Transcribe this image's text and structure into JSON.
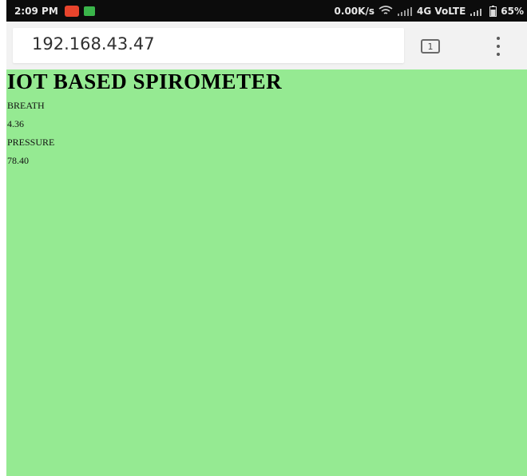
{
  "status_bar": {
    "time": "2:09 PM",
    "network_speed": "0.00K/s",
    "network_type": "4G VoLTE",
    "battery": "65%",
    "icons": [
      "notification-u-icon",
      "notification-green-icon",
      "wifi-icon",
      "signal-icon",
      "signal-icon",
      "battery-icon"
    ]
  },
  "browser": {
    "url": "192.168.43.47",
    "tab_count": "1",
    "menu_icon": "overflow-menu-icon"
  },
  "page": {
    "title": "IOT BASED SPIROMETER",
    "breath_label": "BREATH",
    "breath_value": "4.36",
    "pressure_label": "PRESSURE",
    "pressure_value": "78.40"
  },
  "colors": {
    "page_background": "#95ea92",
    "status_bar": "#0c0c0c",
    "toolbar": "#f2f2f2",
    "notification_u": "#e8442c",
    "notification_green": "#3ab54a"
  }
}
